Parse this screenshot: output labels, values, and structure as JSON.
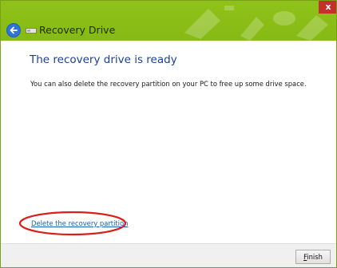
{
  "window": {
    "title": "Recovery Drive",
    "close_glyph": "x",
    "accent_color": "#8fc31a",
    "back_icon": "back-arrow-icon",
    "drive_icon": "drive-icon"
  },
  "main": {
    "heading": "The recovery drive is ready",
    "body": "You can also delete the recovery partition on your PC to free up some drive space.",
    "delete_link": "Delete the recovery partition",
    "highlight_color": "#d8201a"
  },
  "footer": {
    "finish_first": "F",
    "finish_rest": "inish"
  }
}
